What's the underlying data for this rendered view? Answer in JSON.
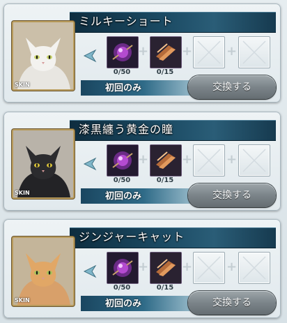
{
  "cards": [
    {
      "title": "ミルキーショート",
      "cat": "white",
      "badge": "SKIN",
      "req1": "0/50",
      "req2": "0/15",
      "limit_label": "初回のみ",
      "button_label": "交換する"
    },
    {
      "title": "漆黒纏う黄金の瞳",
      "cat": "black",
      "badge": "SKIN",
      "req1": "0/50",
      "req2": "0/15",
      "limit_label": "初回のみ",
      "button_label": "交換する"
    },
    {
      "title": "ジンジャーキャット",
      "cat": "ginger",
      "badge": "SKIN",
      "req1": "0/50",
      "req2": "0/15",
      "limit_label": "初回のみ",
      "button_label": "交換する"
    }
  ],
  "icons": {
    "arrow": "left-arrow-icon",
    "plus": "plus-icon",
    "empty_slot": "empty-slot-icon",
    "item1": "purple-orb-item-icon",
    "item2": "bronze-ingot-item-icon"
  },
  "colors": {
    "title_bar": "#1b4a63",
    "button": "#7b8489",
    "portrait_border": "#b89b5c"
  }
}
